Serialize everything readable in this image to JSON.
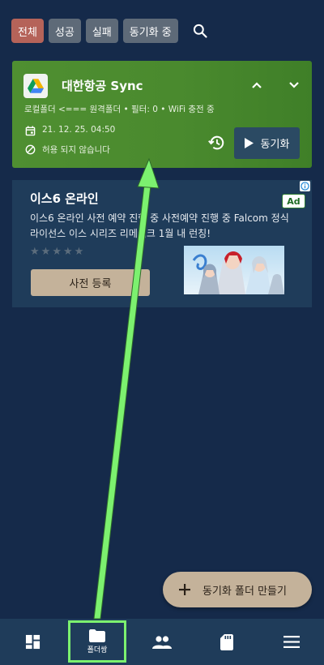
{
  "filters": {
    "all": "전체",
    "success": "성공",
    "failed": "실패",
    "syncing": "동기화 중"
  },
  "sync_card": {
    "title": "대한항공 Sync",
    "subtitle": "로컬폴더 <=== 원격폴더 • 필터: 0 • WiFi 충전 중",
    "last_sync": "21. 12. 25. 04:50",
    "status": "허용 되지 않습니다",
    "sync_button": "동기화",
    "colors": {
      "card": "#4a8a2e",
      "button": "#2b4a63"
    }
  },
  "ad": {
    "title": "이스6 온라인",
    "badge": "Ad",
    "description": "이스6 온라인 사전 예약 진행 중 사전예약 진행 중 Falcom 정식 라이선스 이스 시리즈 리메이크 1월 내 런칭!",
    "rating": 0,
    "cta": "사전 등록"
  },
  "fab": {
    "label": "동기화 폴더 만들기"
  },
  "nav": {
    "items": [
      {
        "icon": "dashboard-icon",
        "label": ""
      },
      {
        "icon": "folder-icon",
        "label": "폴더쌍"
      },
      {
        "icon": "people-icon",
        "label": ""
      },
      {
        "icon": "sd-card-icon",
        "label": ""
      },
      {
        "icon": "menu-icon",
        "label": ""
      }
    ],
    "selected_index": 1
  },
  "colors": {
    "background": "#152a4a",
    "chip": "#5e6a78",
    "chip_active": "#b56359",
    "accent": "#c4b29a",
    "annotation": "#7cf16f"
  }
}
